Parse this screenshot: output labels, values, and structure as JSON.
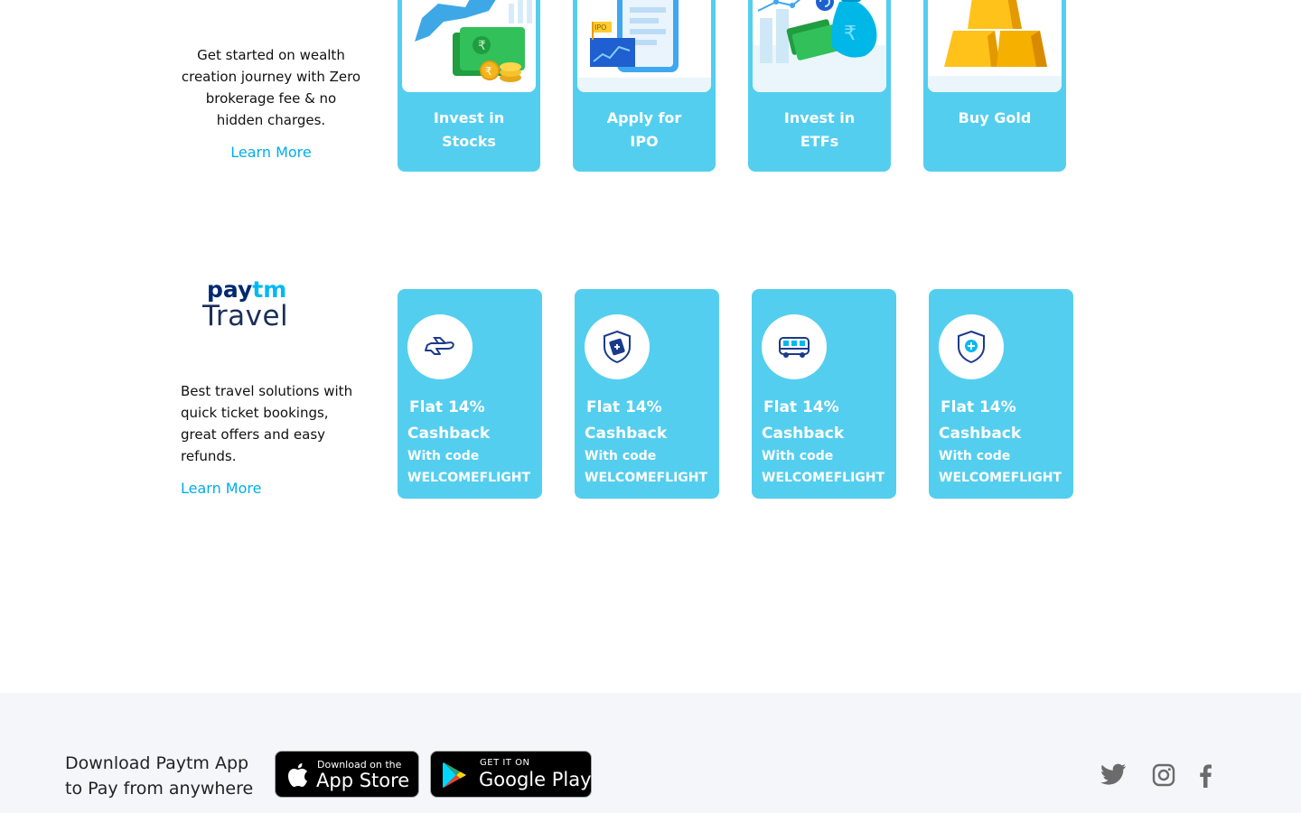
{
  "invest": {
    "description": "Get started on wealth creation journey with Zero brokerage fee & no hidden charges.",
    "learn_more": "Learn More",
    "cards": [
      {
        "label": "Invest in Stocks",
        "icon": "bull-money-icon"
      },
      {
        "label": "Apply for IPO",
        "icon": "ipo-phone-icon"
      },
      {
        "label": "Invest in ETFs",
        "icon": "money-bag-icon"
      },
      {
        "label": "Buy Gold",
        "icon": "gold-bars-icon"
      }
    ]
  },
  "travel": {
    "logo_word": "Paytm",
    "logo_word_a": "pay",
    "logo_word_b": "tm",
    "logo_sub": "Travel",
    "description": "Best travel solutions with quick ticket bookings, great offers and easy refunds.",
    "learn_more": "Learn More",
    "cards": [
      {
        "icon": "flight-icon",
        "title_1": "Flat 14%",
        "title_2": "Cashback",
        "sub_1": "With code",
        "sub_2": "WELCOMEFLIGHT"
      },
      {
        "icon": "ticket-shield-icon",
        "title_1": "Flat 14%",
        "title_2": "Cashback",
        "sub_1": "With code",
        "sub_2": "WELCOMEFLIGHT"
      },
      {
        "icon": "bus-icon",
        "title_1": "Flat 14%",
        "title_2": "Cashback",
        "sub_1": "With code",
        "sub_2": "WELCOMEFLIGHT"
      },
      {
        "icon": "insurance-shield-icon",
        "title_1": "Flat 14%",
        "title_2": "Cashback",
        "sub_1": "With code",
        "sub_2": "WELCOMEFLIGHT"
      }
    ]
  },
  "footer": {
    "download_text": "Download Paytm App to Pay from anywhere",
    "app_store_small": "Download on the",
    "app_store_big": "App Store",
    "google_play_small": "GET IT ON",
    "google_play_big": "Google Play",
    "social": [
      "twitter-icon",
      "instagram-icon",
      "facebook-icon"
    ]
  },
  "colors": {
    "card_blue": "#54ceef",
    "link_blue": "#00aee8",
    "paytm_navy": "#002970",
    "paytm_cyan": "#00b9f1",
    "footer_bg": "#f4f6fa"
  }
}
